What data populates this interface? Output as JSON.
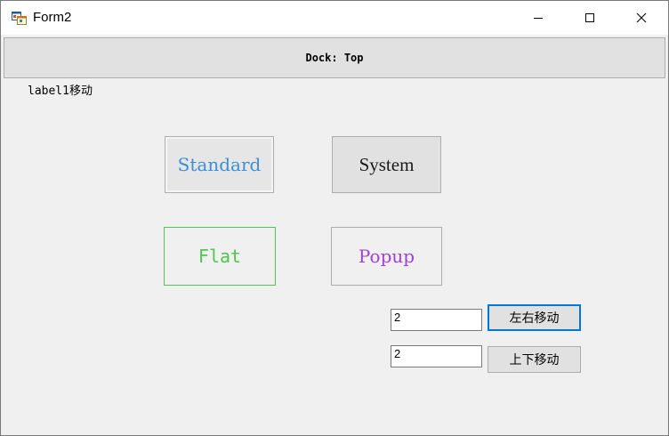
{
  "window": {
    "title": "Form2",
    "icons": {
      "app": "winforms-app-icon",
      "minimize": "minimize-icon",
      "maximize": "maximize-icon",
      "close": "close-icon"
    }
  },
  "panel": {
    "dock_label": "Dock: Top"
  },
  "label1": {
    "text": "label1移动"
  },
  "buttons": {
    "standard": "Standard",
    "system": "System",
    "flat": "Flat",
    "popup": "Popup"
  },
  "controls": {
    "horizontal_value": "2",
    "vertical_value": "2",
    "move_lr_label": "左右移动",
    "move_ud_label": "上下移动"
  },
  "colors": {
    "standard_text": "#3b8fd9",
    "flat_text": "#4ec74e",
    "flat_border": "#4ec74e",
    "popup_text": "#a040d8",
    "focus_border": "#0078d7"
  }
}
